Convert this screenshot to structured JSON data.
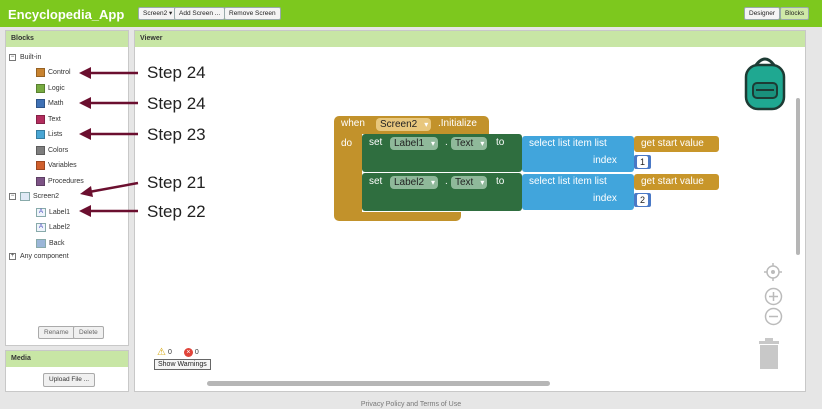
{
  "app_title": "Encyclopedia_App",
  "toolbar": {
    "screen_select": "Screen2 ▾",
    "add_screen": "Add Screen ...",
    "remove_screen": "Remove Screen",
    "designer": "Designer",
    "blocks": "Blocks"
  },
  "blocks_panel": {
    "header": "Blocks",
    "builtin": {
      "label": "Built-in",
      "items": [
        {
          "label": "Control",
          "color": "#c88330"
        },
        {
          "label": "Logic",
          "color": "#77ab41"
        },
        {
          "label": "Math",
          "color": "#3f71b5"
        },
        {
          "label": "Text",
          "color": "#b32d5e"
        },
        {
          "label": "Lists",
          "color": "#49a6d4"
        },
        {
          "label": "Colors",
          "color": "#7d7d7d"
        },
        {
          "label": "Variables",
          "color": "#d05f2d"
        },
        {
          "label": "Procedures",
          "color": "#7c5385"
        }
      ]
    },
    "screen": {
      "label": "Screen2",
      "components": [
        {
          "label": "Label1",
          "icon": "A"
        },
        {
          "label": "Label2",
          "icon": "A"
        },
        {
          "label": "Back",
          "icon": ""
        }
      ]
    },
    "any_component": "Any component",
    "rename": "Rename",
    "delete": "Delete"
  },
  "media_panel": {
    "header": "Media",
    "upload": "Upload File ..."
  },
  "viewer": {
    "header": "Viewer",
    "warnings_count": "0",
    "errors_count": "0",
    "show_warnings": "Show Warnings"
  },
  "annotations": [
    "Step 24",
    "Step 24",
    "Step 23",
    "Step 21",
    "Step 22"
  ],
  "event_block": {
    "when": "when",
    "screen": "Screen2",
    "event": ".Initialize",
    "do": "do"
  },
  "set_blocks": [
    {
      "set": "set",
      "component": "Label1",
      "property": "Text",
      "to": "to",
      "dot": ".",
      "select": "select list item  list",
      "index": "index",
      "procedure": "get start value",
      "index_value": "1"
    },
    {
      "set": "set",
      "component": "Label2",
      "property": "Text",
      "to": "to",
      "dot": ".",
      "select": "select list item  list",
      "index": "index",
      "procedure": "get start value",
      "index_value": "2"
    }
  ],
  "footer": "Privacy Policy and Terms of Use",
  "colors": {
    "topbar": "#7dc81e",
    "panel_header": "#c8e6a5",
    "control_block": "#c2922b",
    "setter_block": "#2f6e3f",
    "list_block": "#41a5dc",
    "procedure_block": "#c8962a",
    "math_block": "#4a79c6",
    "arrow": "#6b0f2f"
  }
}
